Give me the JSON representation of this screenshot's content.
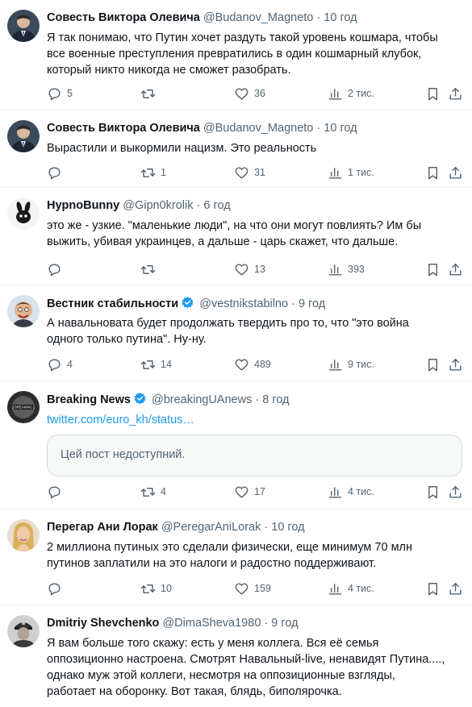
{
  "tweets": [
    {
      "name": "Совесть Виктора Олевича",
      "handle": "@Budanov_Magneto",
      "sep": "·",
      "time": "10 год",
      "verified": false,
      "lines": [
        "Я так понимаю, что Путин хочет раздуть такой уровень кошмара, чтобы",
        "все военные преступления превратились в один кошмарный клубок,",
        "который никто никогда не сможет разобрать."
      ],
      "replies": "5",
      "retweets": "",
      "likes": "36",
      "views": "2 тис."
    },
    {
      "name": "Совесть Виктора Олевича",
      "handle": "@Budanov_Magneto",
      "sep": "·",
      "time": "10 год",
      "verified": false,
      "lines": [
        "Вырастили и выкормили нацизм. Это реальность"
      ],
      "replies": "",
      "retweets": "1",
      "likes": "31",
      "views": "1 тис."
    },
    {
      "name": "HypnoBunny",
      "handle": "@Gipn0krolik",
      "sep": "·",
      "time": "6 год",
      "verified": false,
      "lines": [
        "это же - узкие. \"маленькие люди\", на что они могут повлиять? Им бы",
        "выжить, убивая украинцев, а дальше - царь скажет, что дальше."
      ],
      "replies": "",
      "retweets": "",
      "likes": "13",
      "views": "393"
    },
    {
      "name": "Вестник стабильности",
      "handle": "@vestnikstabilno",
      "sep": "·",
      "time": "9 год",
      "verified": true,
      "lines": [
        "А навальновата будет продолжать твердить про то, что \"это война",
        "одного только путина\".  Ну-ну."
      ],
      "replies": "4",
      "retweets": "14",
      "likes": "489",
      "views": "9 тис."
    },
    {
      "name": "Breaking News",
      "handle": "@breakingUAnews",
      "sep": "·",
      "time": "8 год",
      "verified": true,
      "link": "twitter.com/euro_kh/status…",
      "quote": "Цей пост недоступний.",
      "lines": [],
      "replies": "",
      "retweets": "4",
      "likes": "17",
      "views": "4 тис."
    },
    {
      "name": "Перегар Ани Лорак",
      "handle": "@PeregarAniLorak",
      "sep": "·",
      "time": "10 год",
      "verified": false,
      "lines": [
        "2 миллиона путиных это сделали физически, еще минимум 70 млн",
        "путинов заплатили на это налоги и радостно поддерживают."
      ],
      "replies": "",
      "retweets": "10",
      "likes": "159",
      "views": "4 тис."
    },
    {
      "name": "Dmitriy Shevchenko",
      "handle": "@DimaSheva1980",
      "sep": "·",
      "time": "9 год",
      "verified": false,
      "lines": [
        "Я вам больше того скажу: есть у меня коллега. Вся её семья",
        "оппозиционно настроена. Смотрят Навальный-live, ненавидят Путина....,",
        "однако муж этой коллеги, несмотря на оппозиционные взгляды,",
        "работает на оборонку. Вот такая, блядь, биполярочка."
      ]
    }
  ],
  "colors": {
    "text": "#0f1419",
    "secondary": "#536471",
    "link": "#1d9bf0",
    "border": "#eff3f4",
    "verified": "#1d9bf0"
  }
}
